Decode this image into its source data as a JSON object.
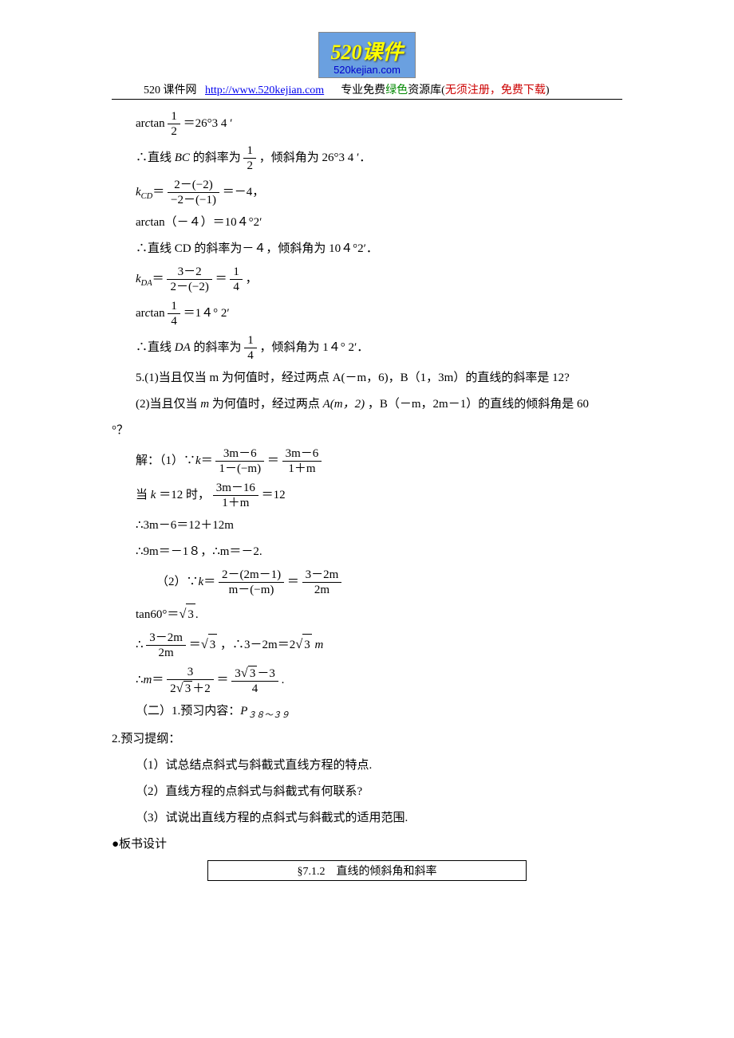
{
  "logo": {
    "main": "520课件",
    "sub": "520kejian.com"
  },
  "header": {
    "site_label": "520 课件网",
    "url": "http://www.520kejian.com",
    "desc_prefix": "专业免费",
    "desc_green": "绿色",
    "desc_mid": "资源库(",
    "desc_red": "无须注册，免费下载",
    "desc_end": ")"
  },
  "body": {
    "l1_a": "ar",
    "l1_b": "c",
    "l1_c": "tan",
    "l1_eq": "＝26°3 4 ′",
    "l2_a": "∴直线",
    "l2_b": "BC",
    "l2_c": "的斜率为",
    "l2_d": "，倾斜角为 26°3 4 ′．",
    "l3_a": "k",
    "l3_sub": "CD",
    "l3_eq": "＝",
    "l3_num": "2－(−2)",
    "l3_den": "−2－(−1)",
    "l3_res": "＝－4，",
    "l4_a": "ar",
    "l4_b": "c",
    "l4_c": "tan（－４）＝10４°2′",
    "l5": "∴直线 CD 的斜率为－４，倾斜角为 10４°2′．",
    "l6_a": "k",
    "l6_sub": "DA",
    "l6_eq": "＝",
    "l6_num": "3－2",
    "l6_den": "2－(−2)",
    "l6_mid": "＝",
    "l6_num2": "1",
    "l6_den2": "4",
    "l6_end": "，",
    "l7_a": "ar",
    "l7_b": "c",
    "l7_c": "tan",
    "l7_eq": "＝1４° 2′",
    "l8_a": "∴直线",
    "l8_b": "DA",
    "l8_c": "的斜率为",
    "l8_d": "，倾斜角为 1４° 2′．",
    "l9": "5.(1)当且仅当 m 为何值时，经过两点 A(－m，6)，B（1，3m）的直线的斜率是 12?",
    "l10_a": "(2)当且仅当",
    "l10_b": "m",
    "l10_c": "为何值时，经过两点",
    "l10_d": "A(m，2)",
    "l10_e": "，B（－m，2m－1）的直线的倾斜角是 60",
    "l10_end": "°？",
    "l11_a": "解：（1）∵",
    "l11_b": "k",
    "l11_eq": "＝",
    "l11_num": "3m－6",
    "l11_den": "1－(−m)",
    "l11_mid": "＝",
    "l11_num2": "3m－6",
    "l11_den2": "1＋m",
    "l12_a": "当",
    "l12_b": "k",
    "l12_c": "＝12 时，",
    "l12_num": "3m－16",
    "l12_den": "1＋m",
    "l12_eq": "＝12",
    "l13": "∴3m－6＝12＋12m",
    "l14": "∴9m＝－1８，∴m＝－2.",
    "l15_a": "（2）∵",
    "l15_b": "k",
    "l15_eq": "＝",
    "l15_num": "2－(2m－1)",
    "l15_den": "m－(−m)",
    "l15_mid": "＝",
    "l15_num2": "3－2m",
    "l15_den2": "2m",
    "l16_a": "tan60°＝",
    "l16_rad": "3",
    "l16_end": ".",
    "l17_a": "∴",
    "l17_num": "3－2m",
    "l17_den": "2m",
    "l17_eq": "＝",
    "l17_rad": "3",
    "l17_mid": "，∴3－2m＝2",
    "l17_rad2": "3",
    "l17_end": " m",
    "l18_a": "∴",
    "l18_b": "m",
    "l18_eq": "＝",
    "l18_num": "3",
    "l18_den_a": "2",
    "l18_den_rad": "3",
    "l18_den_b": "＋2",
    "l18_mid": "＝",
    "l18_num2_a": "3",
    "l18_num2_rad": "3",
    "l18_num2_b": "－3",
    "l18_den2": "4",
    "l18_end": ".",
    "l19_a": "（二）1.预习内容：",
    "l19_b": "P",
    "l19_sub": "３８～３９",
    "l20": "2.预习提纲：",
    "l21": "（1）试总结点斜式与斜截式直线方程的特点.",
    "l22": "（2）直线方程的点斜式与斜截式有何联系?",
    "l23": "（3）试说出直线方程的点斜式与斜截式的适用范围.",
    "l24": "●板书设计",
    "board": "§7.1.2　直线的倾斜角和斜率"
  }
}
